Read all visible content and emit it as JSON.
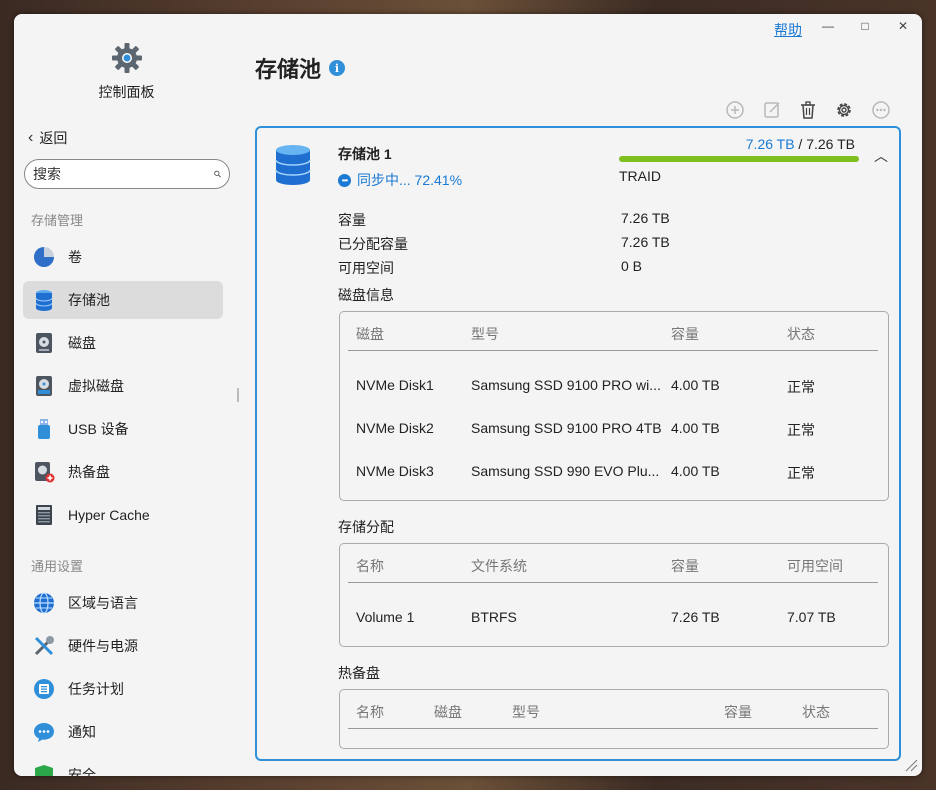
{
  "window": {
    "help_label": "帮助",
    "minimize": "—",
    "maximize": "□",
    "close": "✕"
  },
  "sidebar": {
    "title": "控制面板",
    "back_label": "返回",
    "search_placeholder": "搜索",
    "section_storage": "存储管理",
    "section_general": "通用设置",
    "storage_items": [
      {
        "label": "卷",
        "icon": "pie-icon"
      },
      {
        "label": "存储池",
        "icon": "database-icon"
      },
      {
        "label": "磁盘",
        "icon": "hdd-icon"
      },
      {
        "label": "虚拟磁盘",
        "icon": "virtual-disk-icon"
      },
      {
        "label": "USB 设备",
        "icon": "usb-icon"
      },
      {
        "label": "热备盘",
        "icon": "hot-spare-icon"
      },
      {
        "label": "Hyper Cache",
        "icon": "ssd-icon"
      }
    ],
    "general_items": [
      {
        "label": "区域与语言",
        "icon": "globe-icon"
      },
      {
        "label": "硬件与电源",
        "icon": "tools-icon"
      },
      {
        "label": "任务计划",
        "icon": "task-list-icon"
      },
      {
        "label": "通知",
        "icon": "chat-bubble-icon"
      },
      {
        "label": "安全",
        "icon": "shield-icon"
      }
    ]
  },
  "main": {
    "title": "存储池",
    "info_glyph": "i"
  },
  "pool": {
    "name": "存储池 1",
    "status": "同步中... 72.41%",
    "used": "7.26 TB",
    "separator": " / ",
    "total": "7.26 TB",
    "usage_fraction": 1.0,
    "raid": "TRAID",
    "collapse_glyph": "︿",
    "props": [
      {
        "key": "容量",
        "value": "7.26 TB"
      },
      {
        "key": "已分配容量",
        "value": "7.26 TB"
      },
      {
        "key": "可用空间",
        "value": "0 B"
      }
    ],
    "disk_info_title": "磁盘信息",
    "disk_headers": [
      "磁盘",
      "型号",
      "容量",
      "状态"
    ],
    "disks": [
      [
        "NVMe Disk1",
        "Samsung SSD 9100 PRO wi...",
        "4.00 TB",
        "正常"
      ],
      [
        "NVMe Disk2",
        "Samsung SSD 9100 PRO 4TB",
        "4.00 TB",
        "正常"
      ],
      [
        "NVMe Disk3",
        "Samsung SSD 990 EVO Plu...",
        "4.00 TB",
        "正常"
      ]
    ],
    "alloc_title": "存储分配",
    "alloc_headers": [
      "名称",
      "文件系统",
      "容量",
      "可用空间"
    ],
    "allocs": [
      [
        "Volume 1",
        "BTRFS",
        "7.26 TB",
        "7.07 TB"
      ]
    ],
    "spare_title": "热备盘",
    "spare_headers": [
      "名称",
      "磁盘",
      "型号",
      "容量",
      "状态"
    ]
  },
  "colors": {
    "accent": "#2f8fd8",
    "link": "#1a7ad4",
    "progress": "#7dbf1e",
    "active_bg": "#dcdcdc"
  }
}
